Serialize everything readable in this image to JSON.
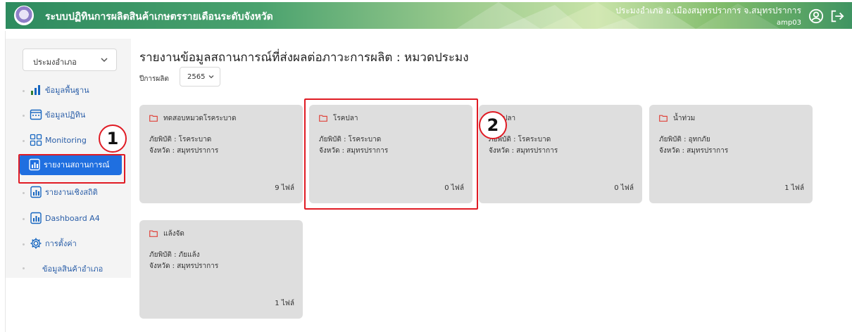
{
  "header": {
    "title": "ระบบปฏิทินการผลิตสินค้าเกษตรรายเดือนระดับจังหวัด",
    "user_location": "ประมงอำเภอ อ.เมืองสมุทรปราการ จ.สมุทรปราการ",
    "username": "amp03",
    "user_icon": "user-circle-icon",
    "logout_icon": "logout-icon"
  },
  "sidebar": {
    "district_select": "ประมงอำเภอ",
    "items": [
      {
        "label": "ข้อมูลพื้นฐาน",
        "icon": "bar-chart-icon"
      },
      {
        "label": "ข้อมูลปฏิทิน",
        "icon": "calendar-icon"
      },
      {
        "label": "Monitoring",
        "icon": "monitoring-grid-icon"
      },
      {
        "label": "รายงานสถานการณ์",
        "icon": "report-icon",
        "active": true
      },
      {
        "label": "รายงานเชิงสถิติ",
        "icon": "report-icon"
      },
      {
        "label": "Dashboard A4",
        "icon": "report-icon"
      },
      {
        "label": "การตั้งค่า",
        "icon": "gear-icon"
      }
    ],
    "sub_item": "ข้อมูลสินค้าอำเภอ"
  },
  "main": {
    "title": "รายงานข้อมูลสถานการณ์ที่ส่งผลต่อภาวะการผลิต : หมวดประมง",
    "year_label": "ปีการผลิต",
    "year_value": "2565",
    "cards": [
      {
        "name": "ทดสอบหมวดโรคระบาด",
        "disaster": "ภัยพิบัติ : โรคระบาด",
        "province": "จังหวัด : สมุทรปราการ",
        "files": "9 ไฟล์"
      },
      {
        "name": "โรคปลา",
        "disaster": "ภัยพิบัติ : โรคระบาด",
        "province": "จังหวัด : สมุทรปราการ",
        "files": "0 ไฟล์"
      },
      {
        "name": "ปลา",
        "disaster": "ภัยพิบัติ : โรคระบาด",
        "province": "จังหวัด : สมุทรปราการ",
        "files": "0 ไฟล์"
      },
      {
        "name": "น้ำท่วม",
        "disaster": "ภัยพิบัติ : อุทกภัย",
        "province": "จังหวัด : สมุทรปราการ",
        "files": "1 ไฟล์"
      },
      {
        "name": "แล้งจัด",
        "disaster": "ภัยพิบัติ : ภัยแล้ง",
        "province": "จังหวัด : สมุทรปราการ",
        "files": "1 ไฟล์"
      }
    ]
  },
  "annotations": {
    "marker_1": "1",
    "marker_2": "2",
    "highlight_color": "#e01b24"
  },
  "colors": {
    "header_green": "#2e8b5f",
    "active_blue": "#1f6fe0",
    "nav_text": "#2a5ea8",
    "folder_red": "#e0443c",
    "card_bg": "#dedede"
  }
}
